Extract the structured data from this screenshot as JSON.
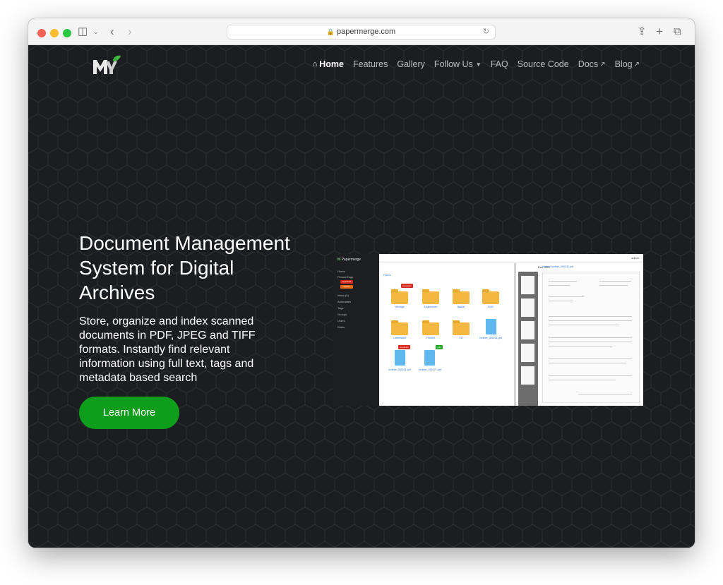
{
  "browser": {
    "url": "papermerge.com",
    "icons": {
      "sidebar": "sidebar-icon",
      "back": "chevron-left-icon",
      "forward": "chevron-right-icon",
      "share": "share-icon",
      "new_tab": "plus-icon",
      "tabs": "tabs-icon"
    }
  },
  "nav": {
    "items": [
      {
        "label": "Home",
        "active": true
      },
      {
        "label": "Features"
      },
      {
        "label": "Gallery"
      },
      {
        "label": "Follow Us"
      },
      {
        "label": "FAQ"
      },
      {
        "label": "Source Code"
      },
      {
        "label": "Docs"
      },
      {
        "label": "Blog"
      }
    ]
  },
  "hero": {
    "title": "Document Management System for Digital Archives",
    "description": "Store, organize and index scanned documents in PDF, JPEG and TIFF formats. Instantly find relevant information using full text, tags and metadata based search",
    "cta": "Learn More"
  },
  "screenshot": {
    "brand": "Papermerge",
    "admin": "admin",
    "sidebar": [
      "Home",
      "Pinned Tags",
      "Inbox (0)",
      "Automates",
      "Tags",
      "Groups",
      "Users",
      "Roles"
    ],
    "tags": [
      "important",
      "xxxxxx"
    ],
    "breadcrumb_left": "Home",
    "breadcrumb_right": "Home / brother_000231.pdf",
    "run_ocr": "Run OCR",
    "folders": [
      "Vertrage",
      "Einkommen",
      "Banke",
      "BVG",
      "Lebenslauf",
      "Freizeit",
      "VG"
    ],
    "documents": [
      "brother_000231.pdf",
      "brother_000231.pdf",
      "brother_000171.pdf"
    ],
    "badges": [
      "important",
      "important",
      "grün"
    ]
  },
  "colors": {
    "accent": "#0f9d1c",
    "page_bg": "#1c1d20",
    "nav_text": "#b9bcc2"
  }
}
